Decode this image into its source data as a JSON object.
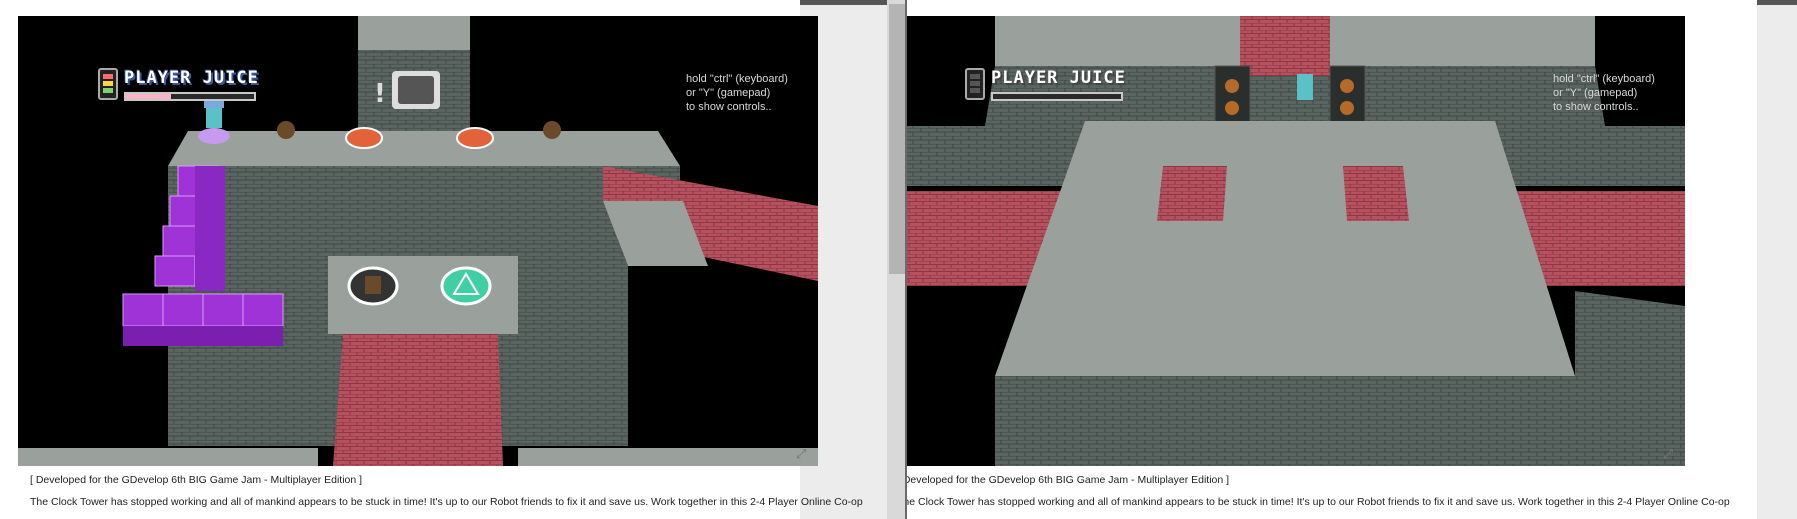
{
  "hud": {
    "juice_label": "PLAYER JUICE",
    "left_juice_fraction": 0.35,
    "right_juice_fraction": 0.0
  },
  "hint": {
    "line1": "hold \"ctrl\" (keyboard)",
    "line2": "or \"Y\" (gamepad)",
    "line3": "to show controls.."
  },
  "description": {
    "heading": "[ Developed for the GDevelop 6th BIG Game Jam - Multiplayer Edition ]",
    "paragraph": "The Clock Tower has stopped working and all of mankind appears to be stuck in time! It's up to our Robot friends to fix it and save us. Work together in this 2-4 Player Online Co-op"
  },
  "colors": {
    "wall": "#5a6460",
    "floor": "#9aa19c",
    "brick_red": "#b8515f",
    "block_purple": "#a033d8",
    "button_orange": "#e2623a",
    "button_green": "#3fcfa3"
  }
}
